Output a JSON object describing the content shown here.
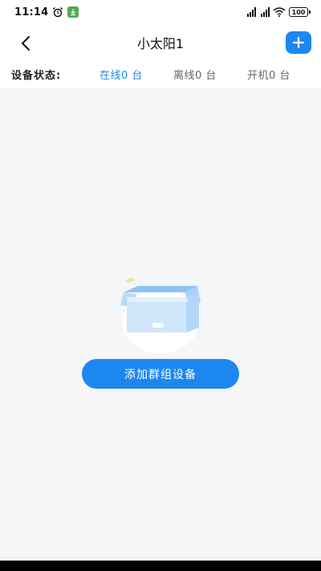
{
  "status_bar": {
    "time": "11:14",
    "battery": "100"
  },
  "header": {
    "title": "小太阳1"
  },
  "device_status": {
    "label": "设备状态:",
    "tabs": [
      {
        "label": "在线0 台",
        "active": true
      },
      {
        "label": "离线0 台",
        "active": false
      },
      {
        "label": "开机0 台",
        "active": false
      }
    ]
  },
  "empty_state": {
    "button_label": "添加群组设备"
  },
  "colors": {
    "accent": "#1d87f0",
    "background": "#f5f6f8"
  },
  "icons": {
    "back": "chevron-left-icon",
    "add": "plus-icon",
    "empty": "empty-box-icon"
  }
}
